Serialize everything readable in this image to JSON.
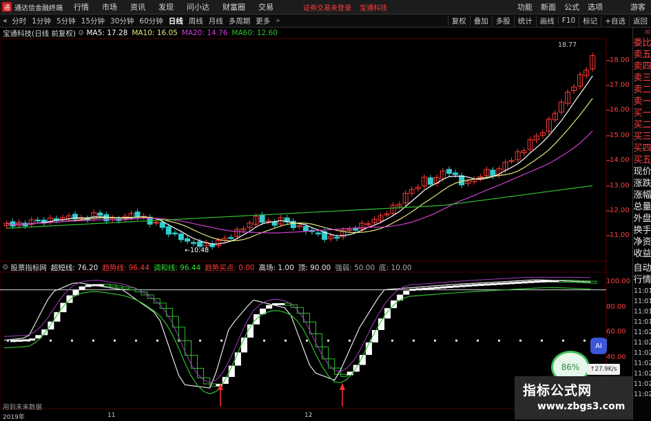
{
  "titlebar": {
    "app_name": "通达信金融终端",
    "menus": [
      "行情",
      "市场",
      "资讯",
      "发现",
      "问小达",
      "财富圈",
      "交易"
    ],
    "login_notice": "证券交易未登录",
    "stock_name": "宝通科技",
    "right_menus": [
      "功能",
      "新面",
      "公式",
      "选项"
    ],
    "user": "游客"
  },
  "toolbar": {
    "periods": [
      "分时",
      "1分钟",
      "5分钟",
      "15分钟",
      "30分钟",
      "60分钟",
      "日线",
      "周线",
      "月线",
      "多周期",
      "更多"
    ],
    "active": "日线",
    "right": [
      "复权",
      "叠加",
      "多股",
      "统计",
      "画线",
      "F10",
      "标记",
      "+自选",
      "返回"
    ]
  },
  "main_chart": {
    "title": "宝通科技(日线 前复权)",
    "ma5_label": "MA5: 17.28",
    "ma10_label": "MA10: 16.05",
    "ma20_label": "MA20: 14.76",
    "ma60_label": "MA60: 12.60",
    "high_label": "18.77",
    "low_label": "10.48",
    "y_ticks": [
      "18.00",
      "17.00",
      "16.00",
      "15.00",
      "14.00",
      "13.00",
      "12.00",
      "11.00"
    ]
  },
  "sub_chart": {
    "title": "股票指标网",
    "values": [
      {
        "label": "超短线: 76.20",
        "color": "#e8e8e8"
      },
      {
        "label": "趋势线: 96.44",
        "color": "#ff3a3a"
      },
      {
        "label": "调和线: 96.44",
        "color": "#33dd33"
      },
      {
        "label": "趋势买点: 0.00",
        "color": "#ff3a3a"
      },
      {
        "label": "高场: 1.00",
        "color": "#e8e8e8"
      },
      {
        "label": "顶: 90.00",
        "color": "#e8e8e8"
      },
      {
        "label": "强弱: 50.00",
        "color": "#aaaaaa"
      },
      {
        "label": "底: 10.00",
        "color": "#aaaaaa"
      }
    ],
    "y_ticks": [
      "100.00",
      "80.00",
      "60.00",
      "40.00"
    ],
    "no_data": "用到未来数据"
  },
  "date_axis": [
    "2019年",
    "11",
    "12"
  ],
  "side_panel": {
    "corner": "Ⅰ0",
    "items": [
      "委比",
      "卖五",
      "卖四",
      "卖三",
      "卖二",
      "卖一",
      "买一",
      "买二",
      "买三",
      "买四",
      "买五",
      "现价",
      "涨跌",
      "涨幅",
      "总量",
      "外盘",
      "换手",
      "净资",
      "收益"
    ],
    "items2": [
      "自动",
      "行情"
    ],
    "times": [
      "11:01",
      "11:01",
      "11:01",
      "11:01",
      "11:02",
      "11:02",
      "11:02",
      "11:02",
      "11:02",
      "11:02",
      "11:02"
    ]
  },
  "overlay": {
    "ai_label": "AI",
    "percent": "86%",
    "speed": "27.9K/s",
    "watermark_title": "指标公式网",
    "watermark_url": "www.zbgs3.com"
  },
  "colors": {
    "up": "#ff3a3a",
    "down": "#33cccc",
    "ma5": "#ffffff",
    "ma10": "#e8e880",
    "ma20": "#d040d0",
    "ma60": "#30c030"
  }
}
